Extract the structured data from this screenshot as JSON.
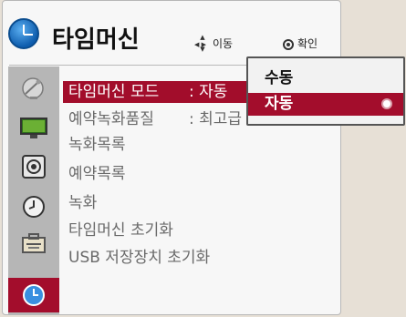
{
  "header": {
    "title": "타임머신",
    "hint_move": "이동",
    "hint_ok": "확인"
  },
  "menu": {
    "items": [
      {
        "label": "타임머신 모드",
        "value": ": 자동"
      },
      {
        "label": "예약녹화품질",
        "value": ": 최고급"
      },
      {
        "label": "녹화목록"
      },
      {
        "label": "예약목록"
      },
      {
        "label": "녹화"
      },
      {
        "label": "타임머신 초기화"
      },
      {
        "label": "USB 저장장치 초기화"
      }
    ]
  },
  "dropdown": {
    "options": [
      "수동",
      "자동"
    ],
    "selected": "자동"
  },
  "sidebar": {
    "icons": [
      "satellite-icon",
      "monitor-icon",
      "speaker-icon",
      "clock-small-icon",
      "toolbox-icon",
      "timemachine-icon"
    ]
  },
  "colors": {
    "accent": "#a30d2c",
    "panel": "#f7f7f7",
    "sidebar": "#b6b6b6",
    "background": "#e7e0d6"
  }
}
